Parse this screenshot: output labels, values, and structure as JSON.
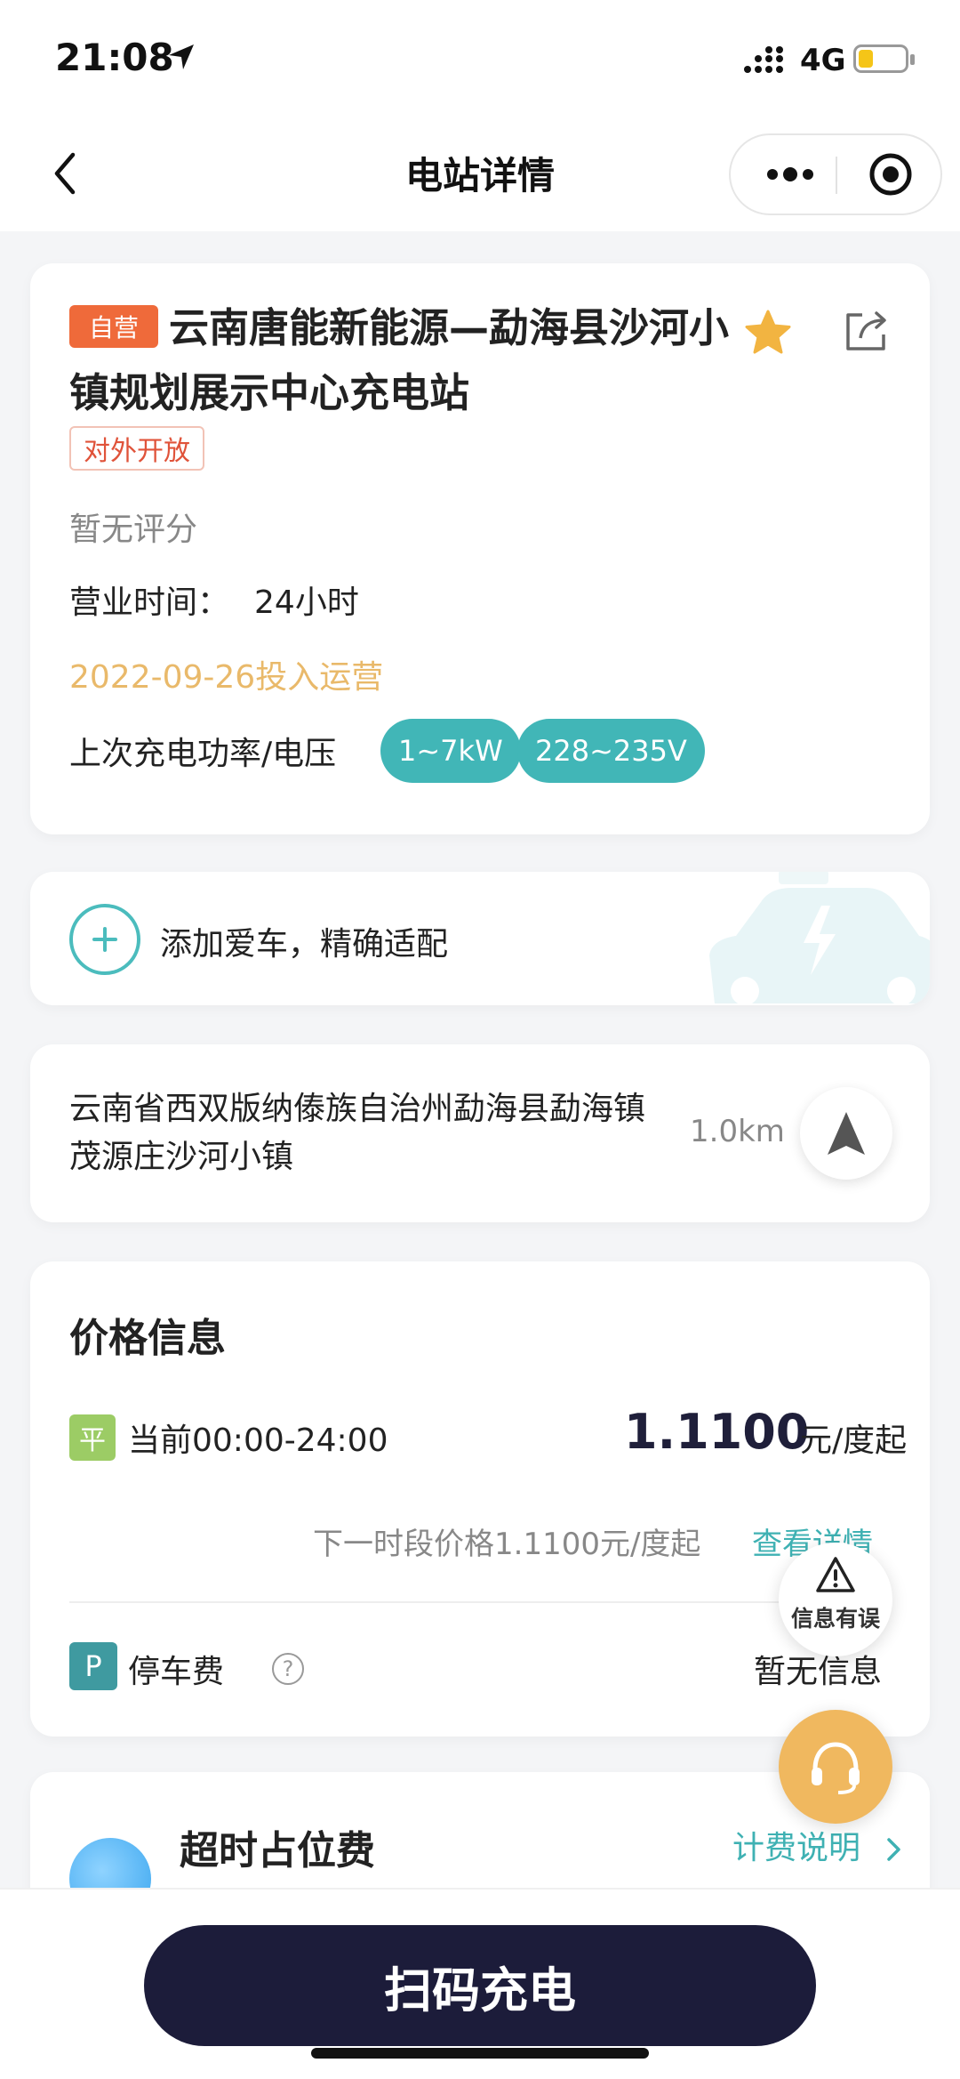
{
  "status_bar": {
    "time": "21:08",
    "network": "4G"
  },
  "nav": {
    "title": "电站详情",
    "back_icon": "chevron-left-icon",
    "more_icon": "more-dots-icon",
    "target_icon": "record-target-icon"
  },
  "station": {
    "self_operated_badge": "自营",
    "name": "云南唐能新能源—勐海县沙河小镇规划展示中心充电站",
    "open_tag": "对外开放",
    "rating": "暂无评分",
    "hours_label": "营业时间：",
    "hours_value": "24小时",
    "operation_date": "2022-09-26投入运营",
    "last_power_label": "上次充电功率/电压",
    "power_pill": "1~7kW",
    "voltage_pill": "228~235V",
    "favorite_icon": "star-icon",
    "share_icon": "share-icon"
  },
  "car": {
    "add_text": "添加爱车，精确适配",
    "plus_icon": "plus-circle-icon"
  },
  "address": {
    "text": "云南省西双版纳傣族自治州勐海县勐海镇茂源庄沙河小镇",
    "distance": "1.0km",
    "navigate_icon": "navigation-arrow-icon"
  },
  "price": {
    "title": "价格信息",
    "period_badge": "平",
    "current_period": "当前00:00-24:00",
    "current_price": "1.1100",
    "price_unit": "元/度起",
    "next_period": "下一时段价格1.1100元/度起",
    "details_link": "查看详情",
    "parking_badge": "P",
    "parking_label": "停车费",
    "parking_help": "?",
    "parking_value": "暂无信息"
  },
  "fabs": {
    "error_label": "信息有误",
    "error_icon": "warning-icon",
    "support_icon": "headset-icon"
  },
  "overtime": {
    "title": "超时占位费",
    "billing_link": "计费说明",
    "clock_icon": "clock-icon"
  },
  "bottom": {
    "scan_label": "扫码充电"
  },
  "colors": {
    "accent_teal": "#41b6b7",
    "badge_orange": "#ef6a3a",
    "date_gold": "#e9b96a",
    "primary_dark": "#1c1c3a",
    "support_gold": "#f0b85f"
  }
}
